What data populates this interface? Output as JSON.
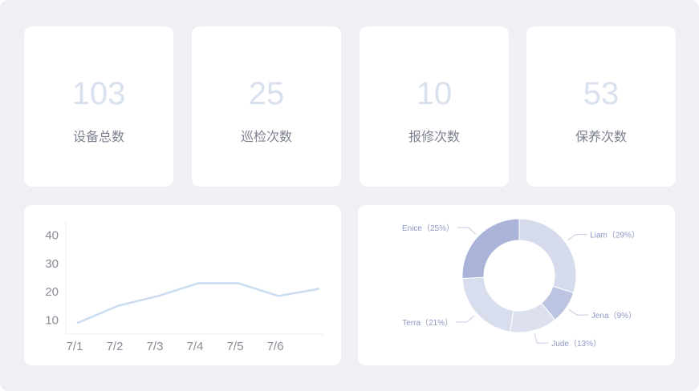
{
  "stats": [
    {
      "value": "103",
      "label": "设备总数"
    },
    {
      "value": "25",
      "label": "巡检次数"
    },
    {
      "value": "10",
      "label": "报修次数"
    },
    {
      "value": "53",
      "label": "保养次数"
    }
  ],
  "colors": {
    "background": "#eef0f5",
    "card": "#ffffff",
    "stat_value": "#d9e0ee",
    "line": "#c9dcf0",
    "donut": [
      "#d6dbec",
      "#bcc4e2",
      "#dde1ef",
      "#d9deef",
      "#a9b4d8"
    ]
  },
  "chart_data": [
    {
      "type": "line",
      "x": [
        "7/1",
        "7/2",
        "7/3",
        "7/4",
        "7/5",
        "7/6",
        ""
      ],
      "values": [
        9,
        15,
        18.5,
        23,
        23,
        18.5,
        21
      ],
      "y_ticks": [
        "10",
        "20",
        "30",
        "40"
      ],
      "ylim": [
        5,
        45
      ],
      "grid": false,
      "title": "",
      "xlabel": "",
      "ylabel": ""
    },
    {
      "type": "pie",
      "donut": true,
      "slices": [
        {
          "name": "Liam",
          "value": 29,
          "label": "Liam（29%）"
        },
        {
          "name": "Jena",
          "value": 9,
          "label": "Jena（9%）"
        },
        {
          "name": "Jude",
          "value": 13,
          "label": "Jude（13%）"
        },
        {
          "name": "Terra",
          "value": 21,
          "label": "Terra（21%）"
        },
        {
          "name": "Enice",
          "value": 25,
          "label": "Enice（25%）"
        }
      ]
    }
  ]
}
